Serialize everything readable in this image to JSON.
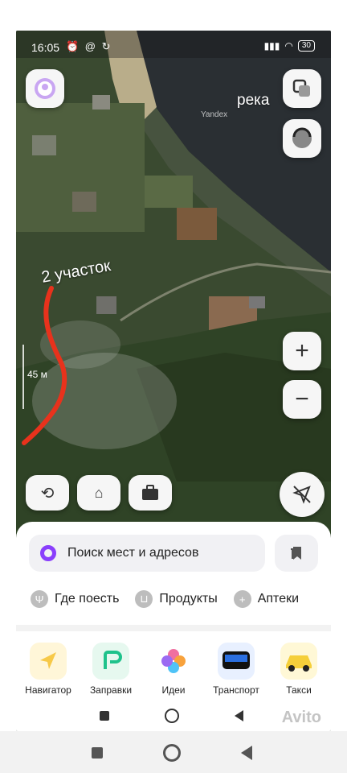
{
  "status_bar": {
    "time": "16:05",
    "icons": "⏰ @ ↻",
    "battery": "30"
  },
  "map": {
    "river_label": "река",
    "watermark": "Yandex",
    "plot_label": "2 участок",
    "scale_label": "45 м"
  },
  "search": {
    "placeholder": "Поиск мест и адресов"
  },
  "categories": [
    {
      "label": "Где поесть",
      "icon": "fork-knife-icon"
    },
    {
      "label": "Продукты",
      "icon": "basket-icon"
    },
    {
      "label": "Аптеки",
      "icon": "plus-icon"
    }
  ],
  "apps": [
    {
      "label": "Навигатор",
      "icon": "navigator-arrow-icon",
      "color": "#f7c948"
    },
    {
      "label": "Заправки",
      "icon": "fuel-icon",
      "color": "#1ec28b"
    },
    {
      "label": "Идеи",
      "icon": "ideas-flower-icon",
      "color": "#f06fa0"
    },
    {
      "label": "Транспорт",
      "icon": "bus-icon",
      "color": "#2b6fe0"
    },
    {
      "label": "Такси",
      "icon": "taxi-icon",
      "color": "#f5cf3a"
    }
  ],
  "watermark_brand": "Avito",
  "colors": {
    "accent_purple": "#8a3ffc",
    "route_red": "#e8321c"
  }
}
